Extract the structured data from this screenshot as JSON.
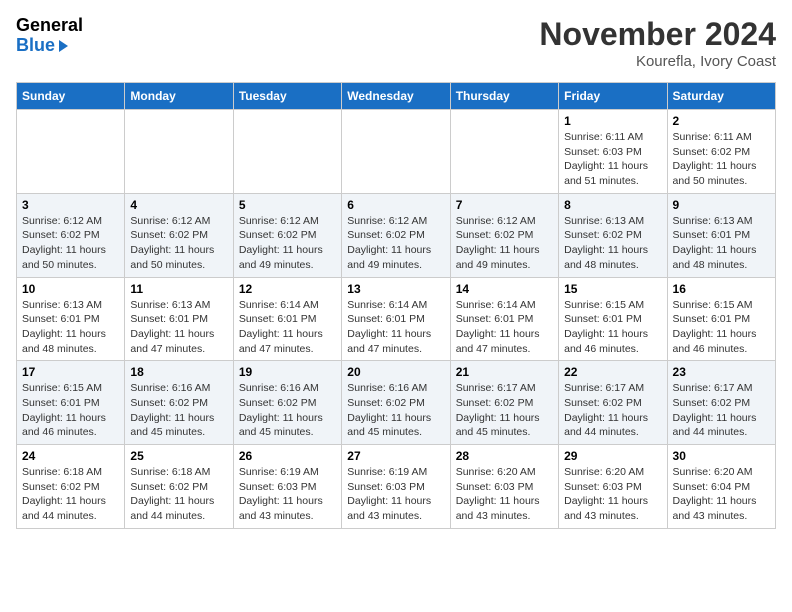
{
  "header": {
    "logo": {
      "general": "General",
      "blue": "Blue",
      "arrow": "▶"
    },
    "title": "November 2024",
    "location": "Kourefla, Ivory Coast"
  },
  "weekdays": [
    "Sunday",
    "Monday",
    "Tuesday",
    "Wednesday",
    "Thursday",
    "Friday",
    "Saturday"
  ],
  "weeks": [
    [
      {
        "day": "",
        "sunrise": "",
        "sunset": "",
        "daylight": ""
      },
      {
        "day": "",
        "sunrise": "",
        "sunset": "",
        "daylight": ""
      },
      {
        "day": "",
        "sunrise": "",
        "sunset": "",
        "daylight": ""
      },
      {
        "day": "",
        "sunrise": "",
        "sunset": "",
        "daylight": ""
      },
      {
        "day": "",
        "sunrise": "",
        "sunset": "",
        "daylight": ""
      },
      {
        "day": "1",
        "sunrise": "Sunrise: 6:11 AM",
        "sunset": "Sunset: 6:03 PM",
        "daylight": "Daylight: 11 hours and 51 minutes."
      },
      {
        "day": "2",
        "sunrise": "Sunrise: 6:11 AM",
        "sunset": "Sunset: 6:02 PM",
        "daylight": "Daylight: 11 hours and 50 minutes."
      }
    ],
    [
      {
        "day": "3",
        "sunrise": "Sunrise: 6:12 AM",
        "sunset": "Sunset: 6:02 PM",
        "daylight": "Daylight: 11 hours and 50 minutes."
      },
      {
        "day": "4",
        "sunrise": "Sunrise: 6:12 AM",
        "sunset": "Sunset: 6:02 PM",
        "daylight": "Daylight: 11 hours and 50 minutes."
      },
      {
        "day": "5",
        "sunrise": "Sunrise: 6:12 AM",
        "sunset": "Sunset: 6:02 PM",
        "daylight": "Daylight: 11 hours and 49 minutes."
      },
      {
        "day": "6",
        "sunrise": "Sunrise: 6:12 AM",
        "sunset": "Sunset: 6:02 PM",
        "daylight": "Daylight: 11 hours and 49 minutes."
      },
      {
        "day": "7",
        "sunrise": "Sunrise: 6:12 AM",
        "sunset": "Sunset: 6:02 PM",
        "daylight": "Daylight: 11 hours and 49 minutes."
      },
      {
        "day": "8",
        "sunrise": "Sunrise: 6:13 AM",
        "sunset": "Sunset: 6:02 PM",
        "daylight": "Daylight: 11 hours and 48 minutes."
      },
      {
        "day": "9",
        "sunrise": "Sunrise: 6:13 AM",
        "sunset": "Sunset: 6:01 PM",
        "daylight": "Daylight: 11 hours and 48 minutes."
      }
    ],
    [
      {
        "day": "10",
        "sunrise": "Sunrise: 6:13 AM",
        "sunset": "Sunset: 6:01 PM",
        "daylight": "Daylight: 11 hours and 48 minutes."
      },
      {
        "day": "11",
        "sunrise": "Sunrise: 6:13 AM",
        "sunset": "Sunset: 6:01 PM",
        "daylight": "Daylight: 11 hours and 47 minutes."
      },
      {
        "day": "12",
        "sunrise": "Sunrise: 6:14 AM",
        "sunset": "Sunset: 6:01 PM",
        "daylight": "Daylight: 11 hours and 47 minutes."
      },
      {
        "day": "13",
        "sunrise": "Sunrise: 6:14 AM",
        "sunset": "Sunset: 6:01 PM",
        "daylight": "Daylight: 11 hours and 47 minutes."
      },
      {
        "day": "14",
        "sunrise": "Sunrise: 6:14 AM",
        "sunset": "Sunset: 6:01 PM",
        "daylight": "Daylight: 11 hours and 47 minutes."
      },
      {
        "day": "15",
        "sunrise": "Sunrise: 6:15 AM",
        "sunset": "Sunset: 6:01 PM",
        "daylight": "Daylight: 11 hours and 46 minutes."
      },
      {
        "day": "16",
        "sunrise": "Sunrise: 6:15 AM",
        "sunset": "Sunset: 6:01 PM",
        "daylight": "Daylight: 11 hours and 46 minutes."
      }
    ],
    [
      {
        "day": "17",
        "sunrise": "Sunrise: 6:15 AM",
        "sunset": "Sunset: 6:01 PM",
        "daylight": "Daylight: 11 hours and 46 minutes."
      },
      {
        "day": "18",
        "sunrise": "Sunrise: 6:16 AM",
        "sunset": "Sunset: 6:02 PM",
        "daylight": "Daylight: 11 hours and 45 minutes."
      },
      {
        "day": "19",
        "sunrise": "Sunrise: 6:16 AM",
        "sunset": "Sunset: 6:02 PM",
        "daylight": "Daylight: 11 hours and 45 minutes."
      },
      {
        "day": "20",
        "sunrise": "Sunrise: 6:16 AM",
        "sunset": "Sunset: 6:02 PM",
        "daylight": "Daylight: 11 hours and 45 minutes."
      },
      {
        "day": "21",
        "sunrise": "Sunrise: 6:17 AM",
        "sunset": "Sunset: 6:02 PM",
        "daylight": "Daylight: 11 hours and 45 minutes."
      },
      {
        "day": "22",
        "sunrise": "Sunrise: 6:17 AM",
        "sunset": "Sunset: 6:02 PM",
        "daylight": "Daylight: 11 hours and 44 minutes."
      },
      {
        "day": "23",
        "sunrise": "Sunrise: 6:17 AM",
        "sunset": "Sunset: 6:02 PM",
        "daylight": "Daylight: 11 hours and 44 minutes."
      }
    ],
    [
      {
        "day": "24",
        "sunrise": "Sunrise: 6:18 AM",
        "sunset": "Sunset: 6:02 PM",
        "daylight": "Daylight: 11 hours and 44 minutes."
      },
      {
        "day": "25",
        "sunrise": "Sunrise: 6:18 AM",
        "sunset": "Sunset: 6:02 PM",
        "daylight": "Daylight: 11 hours and 44 minutes."
      },
      {
        "day": "26",
        "sunrise": "Sunrise: 6:19 AM",
        "sunset": "Sunset: 6:03 PM",
        "daylight": "Daylight: 11 hours and 43 minutes."
      },
      {
        "day": "27",
        "sunrise": "Sunrise: 6:19 AM",
        "sunset": "Sunset: 6:03 PM",
        "daylight": "Daylight: 11 hours and 43 minutes."
      },
      {
        "day": "28",
        "sunrise": "Sunrise: 6:20 AM",
        "sunset": "Sunset: 6:03 PM",
        "daylight": "Daylight: 11 hours and 43 minutes."
      },
      {
        "day": "29",
        "sunrise": "Sunrise: 6:20 AM",
        "sunset": "Sunset: 6:03 PM",
        "daylight": "Daylight: 11 hours and 43 minutes."
      },
      {
        "day": "30",
        "sunrise": "Sunrise: 6:20 AM",
        "sunset": "Sunset: 6:04 PM",
        "daylight": "Daylight: 11 hours and 43 minutes."
      }
    ]
  ]
}
